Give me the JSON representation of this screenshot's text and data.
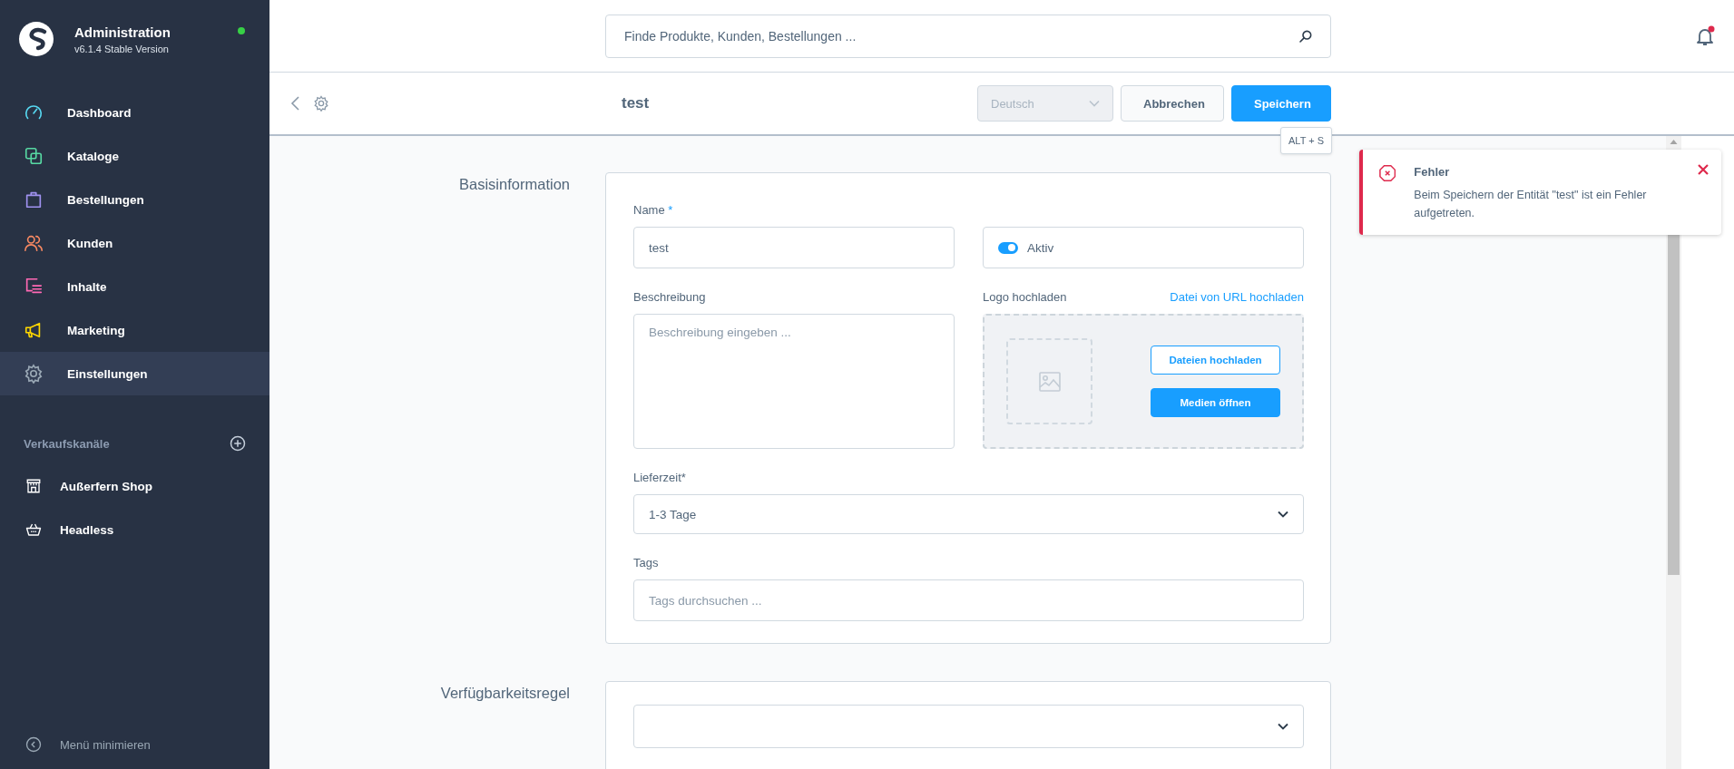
{
  "sidebar": {
    "app_title": "Administration",
    "version": "v6.1.4 Stable Version",
    "status_online": true,
    "nav": [
      {
        "label": "Dashboard",
        "color": "#57d9f2",
        "selected": false
      },
      {
        "label": "Kataloge",
        "color": "#57d9a3",
        "selected": false
      },
      {
        "label": "Bestellungen",
        "color": "#a092f0",
        "selected": false
      },
      {
        "label": "Kunden",
        "color": "#f88962",
        "selected": false
      },
      {
        "label": "Inhalte",
        "color": "#ff68b4",
        "selected": false
      },
      {
        "label": "Marketing",
        "color": "#ffd700",
        "selected": false
      },
      {
        "label": "Einstellungen",
        "color": "#9aa8b5",
        "selected": true
      }
    ],
    "sales_channels": {
      "heading": "Verkaufskanäle",
      "items": [
        {
          "label": "Außerfern Shop"
        },
        {
          "label": "Headless"
        }
      ]
    },
    "collapse_label": "Menü minimieren"
  },
  "header": {
    "search_placeholder": "Finde Produkte, Kunden, Bestellungen ...",
    "has_notification": true
  },
  "smart_bar": {
    "title": "test",
    "language": {
      "value": "Deutsch",
      "disabled": true
    },
    "buttons": [
      {
        "label": "Abbrechen",
        "kind": "secondary"
      },
      {
        "label": "Speichern",
        "kind": "primary"
      }
    ],
    "tooltip": "ALT + S"
  },
  "sections": [
    {
      "kind": "basic",
      "title": "Basisinformation",
      "name": {
        "label": "Name",
        "required_mark": "*",
        "value": "test"
      },
      "active": {
        "label": "Aktiv",
        "on": true
      },
      "description": {
        "label": "Beschreibung",
        "placeholder": "Beschreibung eingeben ..."
      },
      "logo": {
        "label": "Logo hochladen",
        "url_link": "Datei von URL hochladen",
        "upload_button": "Dateien hochladen",
        "media_button": "Medien öffnen"
      },
      "delivery": {
        "label": "Lieferzeit*",
        "value": "1-3 Tage"
      },
      "tags": {
        "label": "Tags",
        "placeholder": "Tags durchsuchen ..."
      }
    },
    {
      "kind": "rule",
      "title": "Verfügbarkeitsregel"
    }
  ],
  "toast": {
    "kind": "error",
    "title": "Fehler",
    "message": "Beim Speichern der Entität \"test\" ist ein Fehler aufgetreten."
  }
}
